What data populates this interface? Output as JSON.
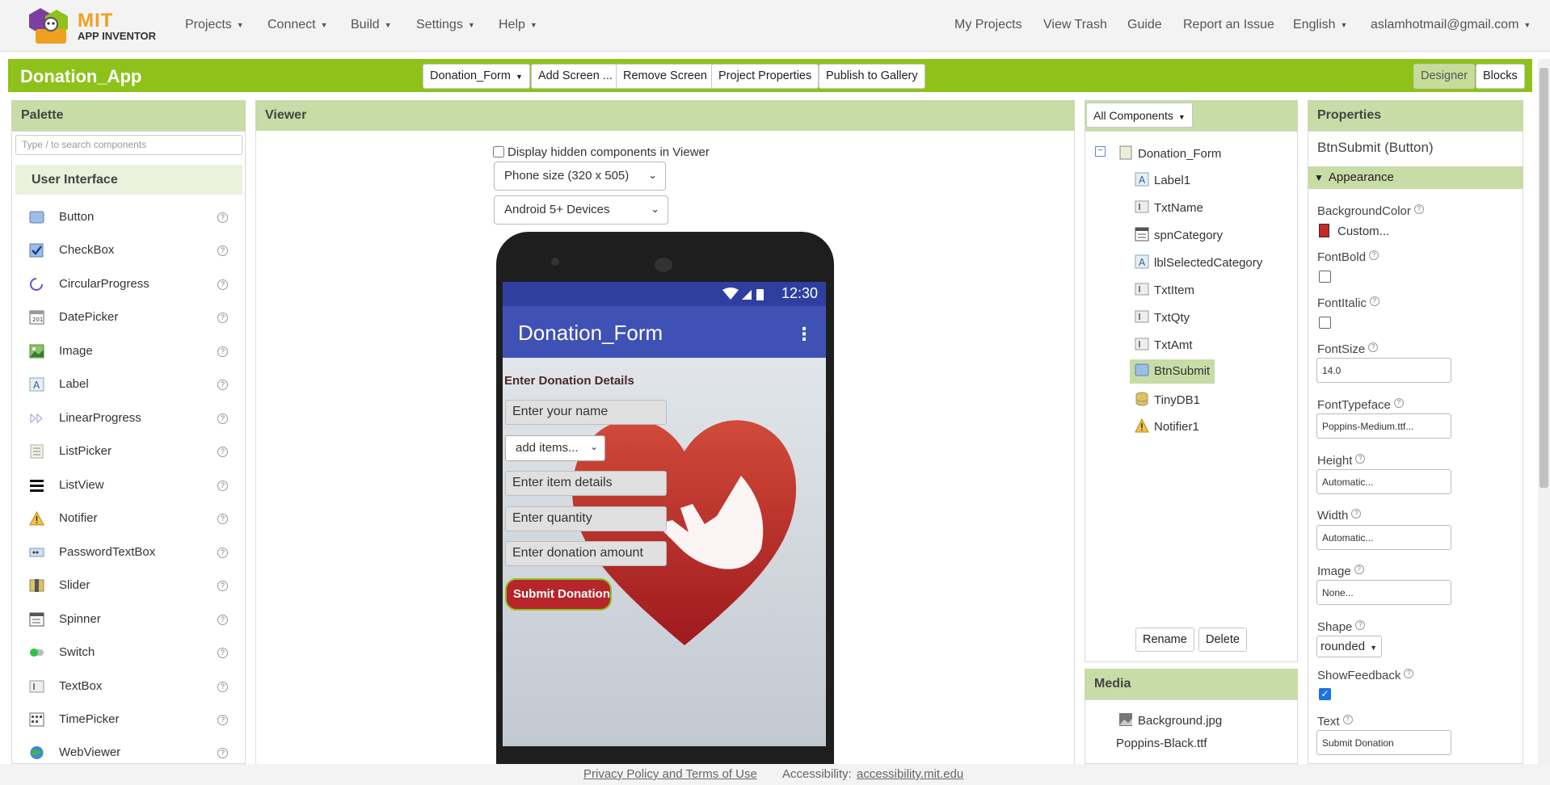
{
  "logo": {
    "mit": "MIT",
    "app_inventor": "APP INVENTOR"
  },
  "topnav": {
    "left": [
      "Projects",
      "Connect",
      "Build",
      "Settings",
      "Help"
    ],
    "right": {
      "my_projects": "My Projects",
      "view_trash": "View Trash",
      "guide": "Guide",
      "report": "Report an Issue",
      "language": "English",
      "account": "aslamhotmail@gmail.com"
    }
  },
  "project": {
    "title": "Donation_App",
    "screen_select": "Donation_Form",
    "buttons": {
      "add_screen": "Add Screen ...",
      "remove_screen": "Remove Screen",
      "project_properties": "Project Properties",
      "publish": "Publish to Gallery"
    },
    "modes": {
      "designer": "Designer",
      "blocks": "Blocks"
    }
  },
  "palette": {
    "title": "Palette",
    "search_placeholder": "Type / to search components",
    "category": "User Interface",
    "items": [
      {
        "label": "Button",
        "icon": "button-icon"
      },
      {
        "label": "CheckBox",
        "icon": "checkbox-icon"
      },
      {
        "label": "CircularProgress",
        "icon": "circular-progress-icon"
      },
      {
        "label": "DatePicker",
        "icon": "datepicker-icon"
      },
      {
        "label": "Image",
        "icon": "image-icon"
      },
      {
        "label": "Label",
        "icon": "label-icon"
      },
      {
        "label": "LinearProgress",
        "icon": "linear-progress-icon"
      },
      {
        "label": "ListPicker",
        "icon": "listpicker-icon"
      },
      {
        "label": "ListView",
        "icon": "listview-icon"
      },
      {
        "label": "Notifier",
        "icon": "notifier-icon"
      },
      {
        "label": "PasswordTextBox",
        "icon": "password-textbox-icon"
      },
      {
        "label": "Slider",
        "icon": "slider-icon"
      },
      {
        "label": "Spinner",
        "icon": "spinner-icon"
      },
      {
        "label": "Switch",
        "icon": "switch-icon"
      },
      {
        "label": "TextBox",
        "icon": "textbox-icon"
      },
      {
        "label": "TimePicker",
        "icon": "timepicker-icon"
      },
      {
        "label": "WebViewer",
        "icon": "webviewer-icon"
      }
    ]
  },
  "viewer": {
    "title": "Viewer",
    "display_hidden": "Display hidden components in Viewer",
    "phone_size": "Phone size (320 x 505)",
    "device": "Android 5+ Devices",
    "phone": {
      "time": "12:30",
      "screen_title": "Donation_Form",
      "label": "Enter Donation Details",
      "name_hint": "Enter your name",
      "spinner": "add items...",
      "item_hint": "Enter item details",
      "qty_hint": "Enter quantity",
      "amount_hint": "Enter donation amount",
      "submit": "Submit Donation"
    }
  },
  "components": {
    "dropdown": "All Components",
    "root": "Donation_Form",
    "items": [
      "Label1",
      "TxtName",
      "spnCategory",
      "lblSelectedCategory",
      "TxtItem",
      "TxtQty",
      "TxtAmt",
      "BtnSubmit",
      "TinyDB1",
      "Notifier1"
    ],
    "selected": "BtnSubmit",
    "rename": "Rename",
    "delete": "Delete"
  },
  "media": {
    "title": "Media",
    "items": [
      "Background.jpg",
      "Poppins-Black.ttf"
    ]
  },
  "properties": {
    "title": "Properties",
    "subtitle": "BtnSubmit (Button)",
    "section": "Appearance",
    "background_color_label": "BackgroundColor",
    "background_color_value": "Custom...",
    "background_color_swatch": "#c62828",
    "font_bold_label": "FontBold",
    "font_bold": false,
    "font_italic_label": "FontItalic",
    "font_italic": false,
    "font_size_label": "FontSize",
    "font_size": "14.0",
    "font_typeface_label": "FontTypeface",
    "font_typeface": "Poppins-Medium.ttf...",
    "height_label": "Height",
    "height": "Automatic...",
    "width_label": "Width",
    "width": "Automatic...",
    "image_label": "Image",
    "image": "None...",
    "shape_label": "Shape",
    "shape": "rounded",
    "show_feedback_label": "ShowFeedback",
    "show_feedback": true,
    "text_label": "Text",
    "text": "Submit Donation"
  },
  "footer": {
    "privacy": "Privacy Policy and Terms of Use",
    "accessibility_label": "Accessibility:",
    "accessibility_link": "accessibility.mit.edu"
  },
  "colors": {
    "accent_green": "#8ec21b",
    "panel_head": "#c8dca7",
    "app_bar": "#3f51b5",
    "status_bar": "#2f3fa0",
    "button_red": "#b5252a"
  }
}
